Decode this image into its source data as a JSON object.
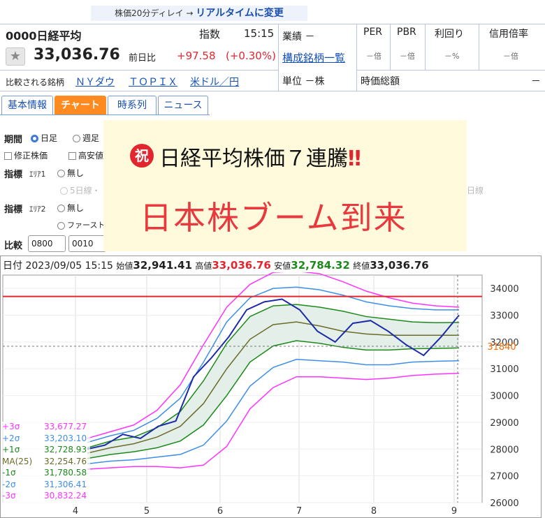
{
  "header": {
    "delay_text": "株価20分ディレイ →",
    "realtime_link": "リアルタイムに変更",
    "code_name": "0000日経平均",
    "category": "指数",
    "time": "15:15",
    "price": "33,036.76",
    "change_label": "前日比",
    "change_value": "+97.58",
    "change_pct": "(+0.30%)",
    "compare_label": "比較される銘柄",
    "compare_links": [
      "ＮＹダウ",
      "ＴＯＰＩＸ",
      "米ドル／円"
    ],
    "results_label": "業績 －",
    "constituents_link": "構成銘柄一覧",
    "unit_label": "単位 －株",
    "per_label": "PER",
    "per_value": "－倍",
    "pbr_label": "PBR",
    "pbr_value": "－倍",
    "yield_label": "利回り",
    "yield_value": "－%",
    "margin_label": "信用倍率",
    "margin_value": "－倍",
    "market_cap_label": "時価総額",
    "market_cap_value": "－"
  },
  "tabs": [
    "基本情報",
    "チャート",
    "時系列",
    "ニュース"
  ],
  "form": {
    "period_label": "期間",
    "period_options": [
      "日足",
      "週足"
    ],
    "adjust_label": "修正株価",
    "high_low_label": "高安値",
    "indicator_label": "指標",
    "area1_label": "ｴﾘｱ1",
    "area2_label": "ｴﾘｱ2",
    "none_label": "無し",
    "ma_partial": "5日線・",
    "ma_partial_right": "日線",
    "first_partial": "ファースト・",
    "compare_label": "比較",
    "compare_inputs": [
      "0800",
      "0010"
    ]
  },
  "overlay": {
    "badge": "祝",
    "line1": "日経平均株価７連騰",
    "exclaim": "‼",
    "line2": "日本株ブーム到来"
  },
  "ohlc": {
    "date_label": "日付",
    "datetime": "2023/09/05 15:15",
    "open_label": "始値",
    "open": "32,941.41",
    "high_label": "高値",
    "high": "33,036.76",
    "low_label": "安値",
    "low": "32,784.32",
    "close_label": "終値",
    "close": "33,036.76"
  },
  "bands": [
    {
      "label": "+3σ",
      "value": "33,677.27",
      "color": "#ff33ff"
    },
    {
      "label": "+2σ",
      "value": "33,203.10",
      "color": "#3d8fe6"
    },
    {
      "label": "+1σ",
      "value": "32,728.93",
      "color": "#1b8a1b"
    },
    {
      "label": "MA(25)",
      "value": "32,254.76",
      "color": "#6b6b2a"
    },
    {
      "label": "-1σ",
      "value": "31,780.58",
      "color": "#1b8a1b"
    },
    {
      "label": "-2σ",
      "value": "31,306.41",
      "color": "#3d8fe6"
    },
    {
      "label": "-3σ",
      "value": "30,832.24",
      "color": "#ff33ff"
    }
  ],
  "chart_data": {
    "type": "line",
    "x_ticks": [
      "4",
      "5",
      "6",
      "7",
      "8",
      "9"
    ],
    "y_ticks": [
      "34000",
      "33000",
      "32000",
      "31000",
      "30000",
      "29000",
      "28000",
      "27000",
      "26000"
    ],
    "ylim": [
      26000,
      34500
    ],
    "cursor_price": "31840",
    "resistance_line": 33700,
    "series": [
      {
        "role": "upper3",
        "color": "#ff33ff",
        "values": [
          28400,
          28650,
          28900,
          29450,
          30400,
          31900,
          33300,
          34150,
          34600,
          34650,
          34550,
          34250,
          33900,
          33650,
          33450,
          33350,
          33300
        ]
      },
      {
        "role": "upper2",
        "color": "#3d8fe6",
        "values": [
          28250,
          28500,
          28700,
          29150,
          29900,
          31250,
          32750,
          33650,
          34000,
          34050,
          33950,
          33750,
          33500,
          33350,
          33250,
          33200,
          33200
        ]
      },
      {
        "role": "upper1",
        "color": "#1b8a1b",
        "values": [
          28050,
          28300,
          28450,
          28800,
          29400,
          30550,
          31950,
          32950,
          33350,
          33400,
          33300,
          33150,
          32950,
          32850,
          32750,
          32720,
          32730
        ]
      },
      {
        "role": "ma",
        "color": "#6b6b2a",
        "values": [
          27850,
          28050,
          28200,
          28450,
          28850,
          29700,
          31000,
          32100,
          32650,
          32750,
          32600,
          32400,
          32300,
          32250,
          32250,
          32250,
          32250
        ]
      },
      {
        "role": "lower1",
        "color": "#1b8a1b",
        "values": [
          27650,
          27800,
          27900,
          28050,
          28300,
          28900,
          30000,
          31250,
          31850,
          32050,
          31950,
          31800,
          31700,
          31700,
          31750,
          31760,
          31780
        ]
      },
      {
        "role": "lower2",
        "color": "#3d8fe6",
        "values": [
          27450,
          27550,
          27600,
          27700,
          27800,
          28150,
          29050,
          30350,
          31050,
          31350,
          31300,
          31250,
          31150,
          31150,
          31250,
          31280,
          31300
        ]
      },
      {
        "role": "lower3",
        "color": "#ff33ff",
        "values": [
          27250,
          27300,
          27350,
          27350,
          27300,
          27400,
          28100,
          29500,
          30300,
          30700,
          30700,
          30650,
          30600,
          30650,
          30750,
          30800,
          30830
        ]
      },
      {
        "role": "close",
        "color": "#1a2aa8",
        "values": [
          28000,
          28150,
          28550,
          28400,
          28850,
          29050,
          30700,
          31400,
          32200,
          33200,
          33500,
          33600,
          33200,
          32400,
          32000,
          32700,
          32800,
          32400,
          31900,
          31500,
          32200,
          33000
        ]
      }
    ]
  }
}
